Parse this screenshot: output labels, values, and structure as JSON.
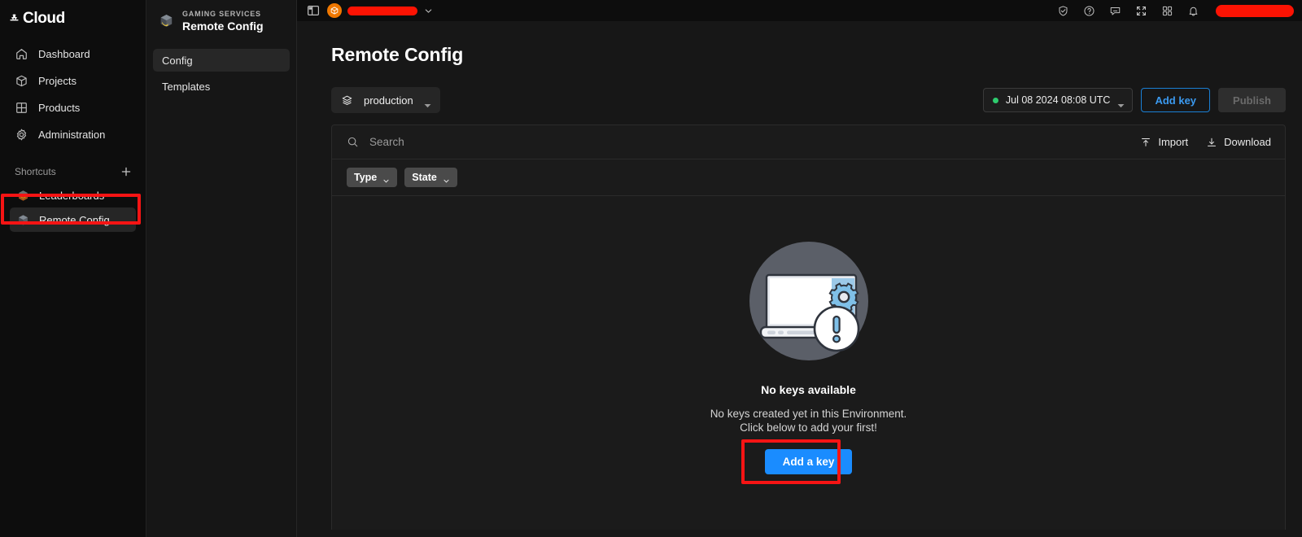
{
  "brand": {
    "name": "Cloud",
    "logo_icon": "cloud-logo-icon"
  },
  "sidebar": {
    "items": [
      {
        "label": "Dashboard",
        "icon": "home-icon"
      },
      {
        "label": "Projects",
        "icon": "cube-icon"
      },
      {
        "label": "Products",
        "icon": "grid-icon"
      },
      {
        "label": "Administration",
        "icon": "gear-icon"
      }
    ],
    "shortcuts": {
      "title": "Shortcuts",
      "add_icon": "plus-icon",
      "items": [
        {
          "label": "Leaderboards",
          "icon": "leaderboards-cube-icon",
          "active": false
        },
        {
          "label": "Remote Config",
          "icon": "remote-config-cube-icon",
          "active": true
        }
      ]
    }
  },
  "subnav": {
    "eyebrow": "GAMING SERVICES",
    "title": "Remote Config",
    "service_icon": "remote-config-cube-icon",
    "items": [
      {
        "label": "Config",
        "active": true
      },
      {
        "label": "Templates",
        "active": false
      }
    ]
  },
  "topbar": {
    "panel_toggle_icon": "panel-toggle-icon",
    "project_avatar_icon": "project-avatar-icon",
    "project_name_redacted": "",
    "project_chevron_icon": "chevron-down-icon",
    "right_icons": [
      "shield-check-icon",
      "help-circle-icon",
      "feedback-icon",
      "fullscreen-icon",
      "apps-grid-icon",
      "bell-icon"
    ],
    "user_redacted": ""
  },
  "page": {
    "title": "Remote Config",
    "environment": {
      "label": "production",
      "icon": "layers-icon",
      "chevron_icon": "triangle-down-icon"
    },
    "release": {
      "label": "Jul 08 2024 08:08 UTC",
      "status_color": "#2ecb6e",
      "chevron_icon": "triangle-down-icon"
    },
    "add_key_label": "Add key",
    "publish_label": "Publish"
  },
  "table": {
    "search": {
      "placeholder": "Search",
      "value": "",
      "icon": "search-icon"
    },
    "import": {
      "label": "Import",
      "icon": "import-icon"
    },
    "download": {
      "label": "Download",
      "icon": "download-icon"
    },
    "filters": [
      {
        "label": "Type",
        "icon": "chevron-down-icon"
      },
      {
        "label": "State",
        "icon": "chevron-down-icon"
      }
    ]
  },
  "empty_state": {
    "illustration": "no-keys-illustration",
    "title": "No keys available",
    "line1": "No keys created yet in this Environment.",
    "line2": "Click below to add your first!",
    "button_label": "Add a key"
  },
  "colors": {
    "page_bg": "#171717",
    "rail_bg": "#0d0d0d",
    "accent_blue": "#1a8cff",
    "link_blue": "#3b9af0",
    "annotation_red": "#f61414",
    "status_green": "#2ecb6e",
    "avatar_orange": "#f07800",
    "redaction_red": "#fc1303"
  }
}
